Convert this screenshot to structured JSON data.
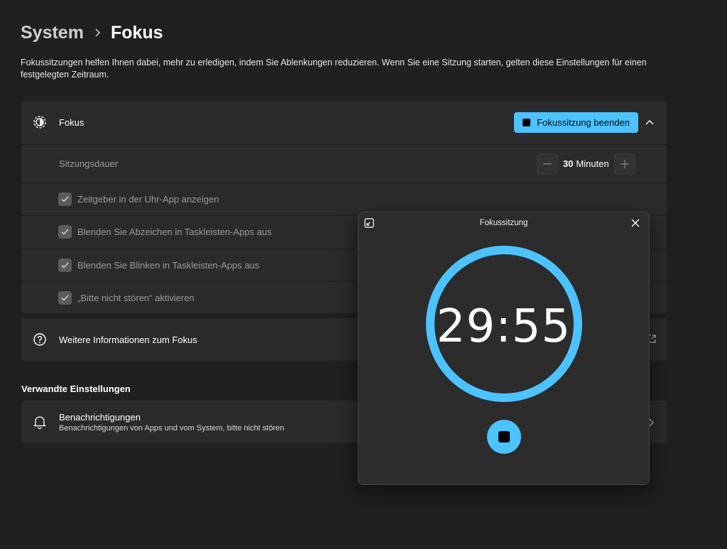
{
  "breadcrumb": {
    "parent": "System",
    "separator": "›",
    "current": "Fokus"
  },
  "description": "Fokussitzungen helfen Ihnen dabei, mehr zu erledigen, indem Sie Ablenkungen reduzieren. Wenn Sie eine Sitzung starten, gelten diese Einstellungen für einen festgelegten Zeitraum.",
  "focus_card": {
    "title": "Fokus",
    "end_button_label": "Fokussitzung beenden",
    "session_duration_label": "Sitzungsdauer",
    "session_duration_value": "30",
    "session_duration_unit": "Minuten",
    "checkboxes": [
      {
        "label": "Zeitgeber in der Uhr-App anzeigen",
        "checked": true
      },
      {
        "label": "Blenden Sie Abzeichen in Taskleisten-Apps aus",
        "checked": true
      },
      {
        "label": "Blenden Sie Blinken in Taskleisten-Apps aus",
        "checked": true
      },
      {
        "label": "„Bitte nicht stören“ aktivieren",
        "checked": true
      }
    ]
  },
  "more_info": {
    "label": "Weitere Informationen zum Fokus"
  },
  "related": {
    "header": "Verwandte Einstellungen",
    "notifications_title": "Benachrichtigungen",
    "notifications_subtitle": "Benachrichtigungen von Apps und vom System, bitte nicht stören"
  },
  "popup": {
    "title": "Fokussitzung",
    "timer": "29:55",
    "progress": 0.997
  },
  "colors": {
    "accent": "#4cc2ff",
    "background": "#202020",
    "card": "#2b2b2b"
  },
  "icons": {
    "focus": "focus-icon",
    "help": "help-icon",
    "bell": "bell-icon",
    "external": "external-link-icon",
    "chevron_up": "chevron-up-icon",
    "chevron_right": "chevron-right-icon"
  }
}
